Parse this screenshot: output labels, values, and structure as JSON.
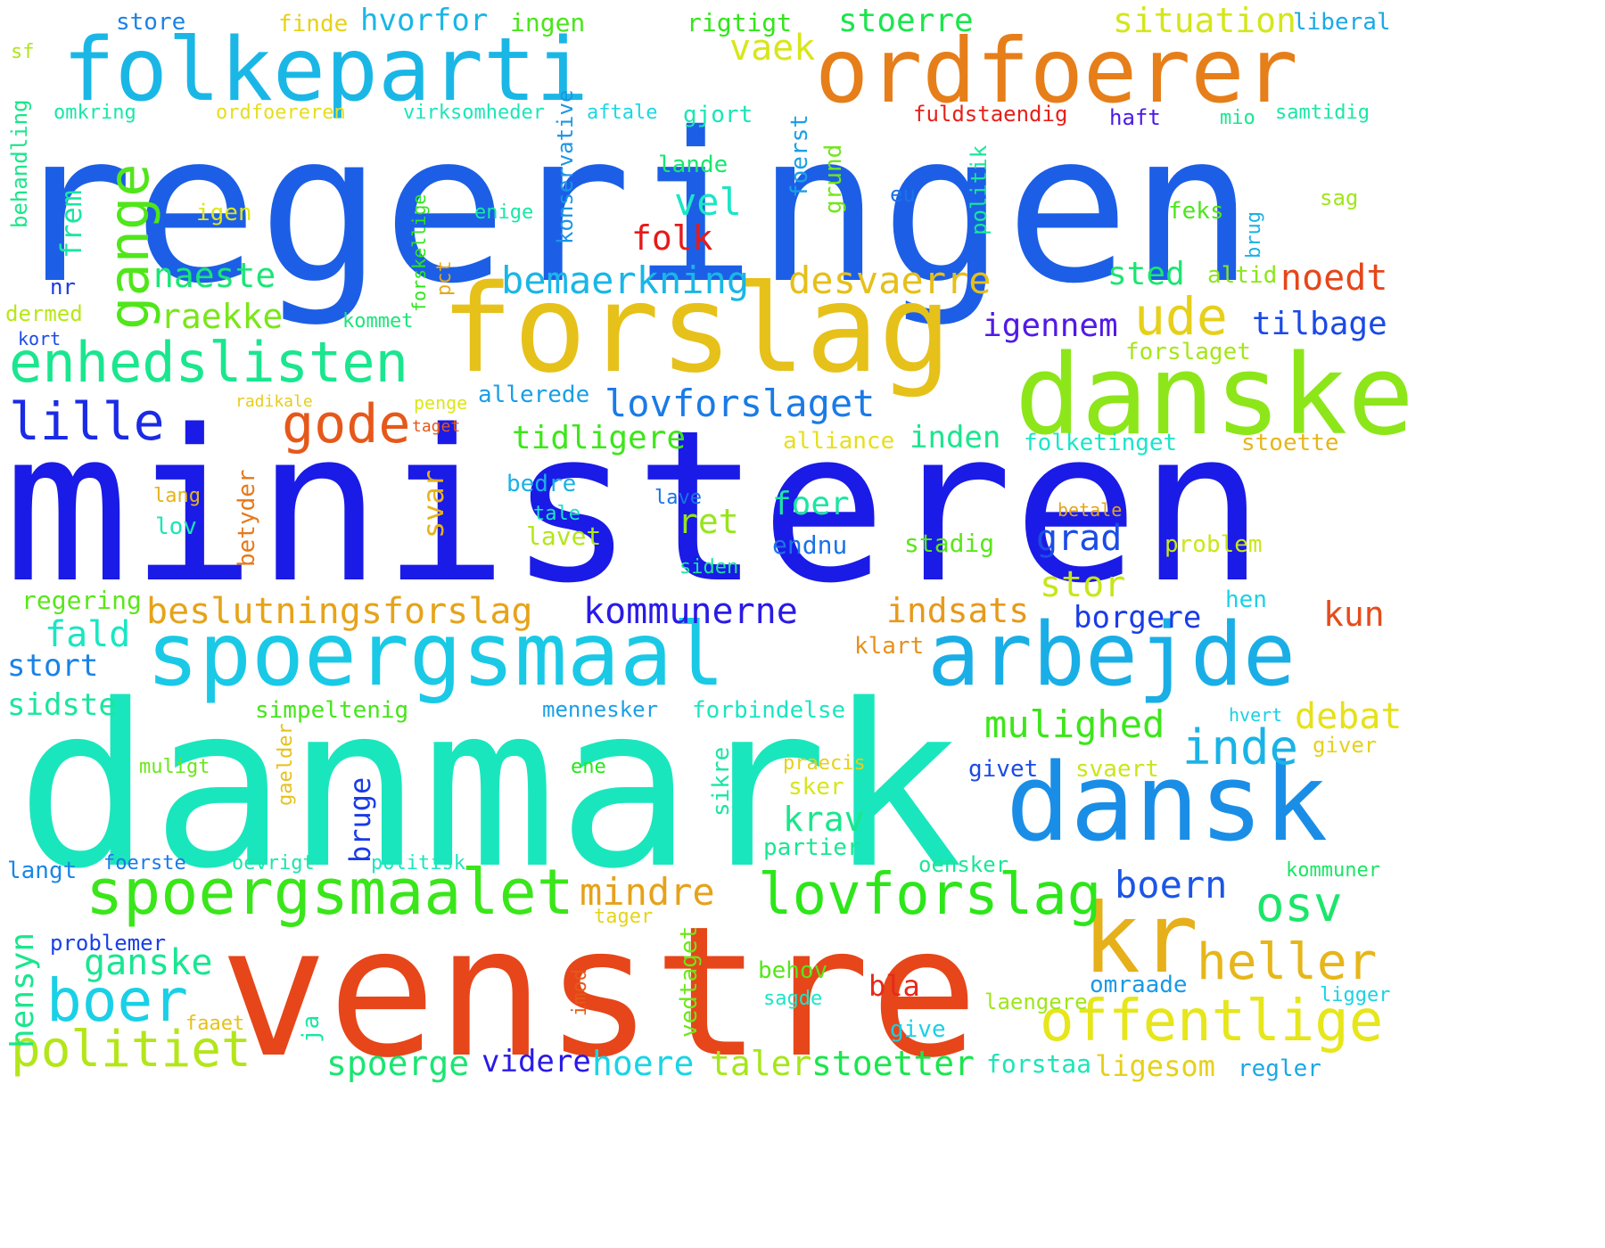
{
  "words": [
    {
      "text": "regeringen",
      "color": "#1c5fe6"
    },
    {
      "text": "ministeren",
      "color": "#1a1be6"
    },
    {
      "text": "danmark",
      "color": "#1ae6bd"
    },
    {
      "text": "venstre",
      "color": "#e6461a"
    },
    {
      "text": "folkeparti",
      "color": "#1ab7e6"
    },
    {
      "text": "ordfoerer",
      "color": "#e67e1a"
    },
    {
      "text": "forslag",
      "color": "#e6c11a"
    },
    {
      "text": "danske",
      "color": "#8de61a"
    },
    {
      "text": "spoergsmaal",
      "color": "#1ac9e6"
    },
    {
      "text": "arbejde",
      "color": "#1aaee6"
    },
    {
      "text": "dansk",
      "color": "#1a8ee6"
    },
    {
      "text": "kr",
      "color": "#e6b01a"
    },
    {
      "text": "enhedslisten",
      "color": "#1ae68e"
    },
    {
      "text": "spoergsmaalet",
      "color": "#3ae61a"
    },
    {
      "text": "lovforslag",
      "color": "#2de61a"
    },
    {
      "text": "offentlige",
      "color": "#e6e61a"
    },
    {
      "text": "heller",
      "color": "#e6b61a"
    },
    {
      "text": "boer",
      "color": "#1ad0e6"
    },
    {
      "text": "politiet",
      "color": "#b3e61a"
    },
    {
      "text": "lille",
      "color": "#1a2be6"
    },
    {
      "text": "gode",
      "color": "#e6581a"
    },
    {
      "text": "ude",
      "color": "#e6d01a"
    },
    {
      "text": "gange",
      "color": "#50e61a"
    },
    {
      "text": "osv",
      "color": "#1ae66a"
    },
    {
      "text": "inde",
      "color": "#1ab3e6"
    },
    {
      "text": "mindre",
      "color": "#e6a21a"
    },
    {
      "text": "beslutningsforslag",
      "color": "#e6a31a"
    },
    {
      "text": "lovforslaget",
      "color": "#1a7be6"
    },
    {
      "text": "bemaerkning",
      "color": "#1ab6e6"
    },
    {
      "text": "desvaerre",
      "color": "#e6bf1a"
    },
    {
      "text": "kommunerne",
      "color": "#2a1ae6"
    },
    {
      "text": "mulighed",
      "color": "#3ce61a"
    },
    {
      "text": "stoerre",
      "color": "#1ae64c"
    },
    {
      "text": "situation",
      "color": "#d4e61a"
    },
    {
      "text": "hvorfor",
      "color": "#1ab6e6"
    },
    {
      "text": "noedt",
      "color": "#e6461a"
    },
    {
      "text": "tilbage",
      "color": "#1a4ae6"
    },
    {
      "text": "igennem",
      "color": "#511ae6"
    },
    {
      "text": "raekke",
      "color": "#7ae61a"
    },
    {
      "text": "naeste",
      "color": "#1ae676"
    },
    {
      "text": "vel",
      "color": "#1ae6c5"
    },
    {
      "text": "vaek",
      "color": "#d8e61a"
    },
    {
      "text": "folk",
      "color": "#e61a1a"
    },
    {
      "text": "sted",
      "color": "#1ae671"
    },
    {
      "text": "tidligere",
      "color": "#3ee61a"
    },
    {
      "text": "inden",
      "color": "#1ae68e"
    },
    {
      "text": "indsats",
      "color": "#e69a1a"
    },
    {
      "text": "stor",
      "color": "#c6e61a"
    },
    {
      "text": "grad",
      "color": "#1a4ce6"
    },
    {
      "text": "fald",
      "color": "#1ae6c2"
    },
    {
      "text": "ganske",
      "color": "#1ae692"
    },
    {
      "text": "boern",
      "color": "#1a56e6"
    },
    {
      "text": "debat",
      "color": "#e6e11a"
    },
    {
      "text": "kun",
      "color": "#e64c1a"
    },
    {
      "text": "hoere",
      "color": "#1ad4e6"
    },
    {
      "text": "taler",
      "color": "#a6e61a"
    },
    {
      "text": "stoetter",
      "color": "#1ae64d"
    },
    {
      "text": "spoerge",
      "color": "#1ae672"
    },
    {
      "text": "videre",
      "color": "#2a1ae6"
    },
    {
      "text": "ligesom",
      "color": "#e6d01a"
    },
    {
      "text": "ret",
      "color": "#96e61a"
    },
    {
      "text": "krav",
      "color": "#1ae68c"
    },
    {
      "text": "foer",
      "color": "#1ae6a3"
    },
    {
      "text": "borgere",
      "color": "#1a3ce6"
    },
    {
      "text": "store",
      "color": "#1a82e6"
    },
    {
      "text": "finde",
      "color": "#e6d21a"
    },
    {
      "text": "ingen",
      "color": "#4ae61a"
    },
    {
      "text": "rigtigt",
      "color": "#33e61a"
    },
    {
      "text": "liberal",
      "color": "#1aa8e6"
    },
    {
      "text": "sf",
      "color": "#aee61a"
    },
    {
      "text": "omkring",
      "color": "#1ae6a7"
    },
    {
      "text": "ordfoereren",
      "color": "#e6de1a"
    },
    {
      "text": "virksomheder",
      "color": "#1ae6bb"
    },
    {
      "text": "aftale",
      "color": "#1ad8e6"
    },
    {
      "text": "gjort",
      "color": "#1ae6b6"
    },
    {
      "text": "fuldstaendig",
      "color": "#e6201a"
    },
    {
      "text": "haft",
      "color": "#4a1ae6"
    },
    {
      "text": "mio",
      "color": "#1ae690"
    },
    {
      "text": "samtidig",
      "color": "#1ae6a5"
    },
    {
      "text": "lande",
      "color": "#1ae66f"
    },
    {
      "text": "igen",
      "color": "#dee61a"
    },
    {
      "text": "enige",
      "color": "#1ae6a5"
    },
    {
      "text": "eu",
      "color": "#1a72e6"
    },
    {
      "text": "feks",
      "color": "#4ce61a"
    },
    {
      "text": "sag",
      "color": "#a0e61a"
    },
    {
      "text": "altid",
      "color": "#8ce61a"
    },
    {
      "text": "nr",
      "color": "#1a3ae6"
    },
    {
      "text": "dermed",
      "color": "#b8e61a"
    },
    {
      "text": "kort",
      "color": "#1a4ae6"
    },
    {
      "text": "kommet",
      "color": "#1ae679"
    },
    {
      "text": "forslaget",
      "color": "#a5e61a"
    },
    {
      "text": "allerede",
      "color": "#1a9ee6"
    },
    {
      "text": "radikale",
      "color": "#e6cd1a"
    },
    {
      "text": "penge",
      "color": "#dce61a"
    },
    {
      "text": "taget",
      "color": "#e6571a"
    },
    {
      "text": "alliance",
      "color": "#e6df1a"
    },
    {
      "text": "folketinget",
      "color": "#1ae6c7"
    },
    {
      "text": "stoette",
      "color": "#e6b61a"
    },
    {
      "text": "lang",
      "color": "#e6b31a"
    },
    {
      "text": "lov",
      "color": "#1ae6b3"
    },
    {
      "text": "bedre",
      "color": "#1ab1e6"
    },
    {
      "text": "tale",
      "color": "#1ae6c3"
    },
    {
      "text": "lave",
      "color": "#1a72e6"
    },
    {
      "text": "lavet",
      "color": "#b3e61a"
    },
    {
      "text": "betale",
      "color": "#e6a21a"
    },
    {
      "text": "endnu",
      "color": "#1a73e6"
    },
    {
      "text": "stadig",
      "color": "#5ae61a"
    },
    {
      "text": "problem",
      "color": "#c9e61a"
    },
    {
      "text": "siden",
      "color": "#1ae69a"
    },
    {
      "text": "regering",
      "color": "#5ae61a"
    },
    {
      "text": "hen",
      "color": "#1ad1e6"
    },
    {
      "text": "klart",
      "color": "#e6911a"
    },
    {
      "text": "stort",
      "color": "#1a82e6"
    },
    {
      "text": "sidste",
      "color": "#1ae69e"
    },
    {
      "text": "simpeltenig",
      "color": "#44e61a"
    },
    {
      "text": "mennesker",
      "color": "#1aa0e6"
    },
    {
      "text": "forbindelse",
      "color": "#1ae6c1"
    },
    {
      "text": "hvert",
      "color": "#1acfe6"
    },
    {
      "text": "giver",
      "color": "#e6d21a"
    },
    {
      "text": "muligt",
      "color": "#6ce61a"
    },
    {
      "text": "ene",
      "color": "#26e61a"
    },
    {
      "text": "praecis",
      "color": "#e6d01a"
    },
    {
      "text": "givet",
      "color": "#1a4ae6"
    },
    {
      "text": "svaert",
      "color": "#cae61a"
    },
    {
      "text": "sker",
      "color": "#d6e61a"
    },
    {
      "text": "partier",
      "color": "#1ae691"
    },
    {
      "text": "langt",
      "color": "#1a86e6"
    },
    {
      "text": "foerste",
      "color": "#1a79e6"
    },
    {
      "text": "oevrigt",
      "color": "#1ae6a9"
    },
    {
      "text": "politisk",
      "color": "#1ae6be"
    },
    {
      "text": "oensker",
      "color": "#1ae697"
    },
    {
      "text": "kommuner",
      "color": "#1ae665"
    },
    {
      "text": "tager",
      "color": "#e6d31a"
    },
    {
      "text": "problemer",
      "color": "#1a40e6"
    },
    {
      "text": "behov",
      "color": "#56e61a"
    },
    {
      "text": "bla",
      "color": "#e62a1a"
    },
    {
      "text": "omraade",
      "color": "#1a99e6"
    },
    {
      "text": "ligger",
      "color": "#1ad2e6"
    },
    {
      "text": "sagde",
      "color": "#1ae6c7"
    },
    {
      "text": "laengere",
      "color": "#9ee61a"
    },
    {
      "text": "faaet",
      "color": "#e6c11a"
    },
    {
      "text": "give",
      "color": "#1ad0e6"
    },
    {
      "text": "forstaa",
      "color": "#1ae6b7"
    },
    {
      "text": "regler",
      "color": "#1aa8e6"
    },
    {
      "text": "behandling",
      "color": "#1ae68a"
    },
    {
      "text": "frem",
      "color": "#1ae6a3"
    },
    {
      "text": "konservative",
      "color": "#1a95e6"
    },
    {
      "text": "foerst",
      "color": "#1a9fe6"
    },
    {
      "text": "grund",
      "color": "#72e61a"
    },
    {
      "text": "politik",
      "color": "#1ae69a"
    },
    {
      "text": "forskellige",
      "color": "#2de61a"
    },
    {
      "text": "pct",
      "color": "#e6a71a"
    },
    {
      "text": "brug",
      "color": "#1ab1e6"
    },
    {
      "text": "svar",
      "color": "#e6b11a"
    },
    {
      "text": "betyder",
      "color": "#e6791a"
    },
    {
      "text": "sikre",
      "color": "#1ae6a4"
    },
    {
      "text": "gaelder",
      "color": "#e6c11a"
    },
    {
      "text": "bruge",
      "color": "#1a3be6"
    },
    {
      "text": "hensyn",
      "color": "#1ae68e"
    },
    {
      "text": "vedtaget",
      "color": "#6ee61a"
    },
    {
      "text": "ja",
      "color": "#1ae6a3"
    },
    {
      "text": "imod",
      "color": "#e6581a"
    }
  ]
}
